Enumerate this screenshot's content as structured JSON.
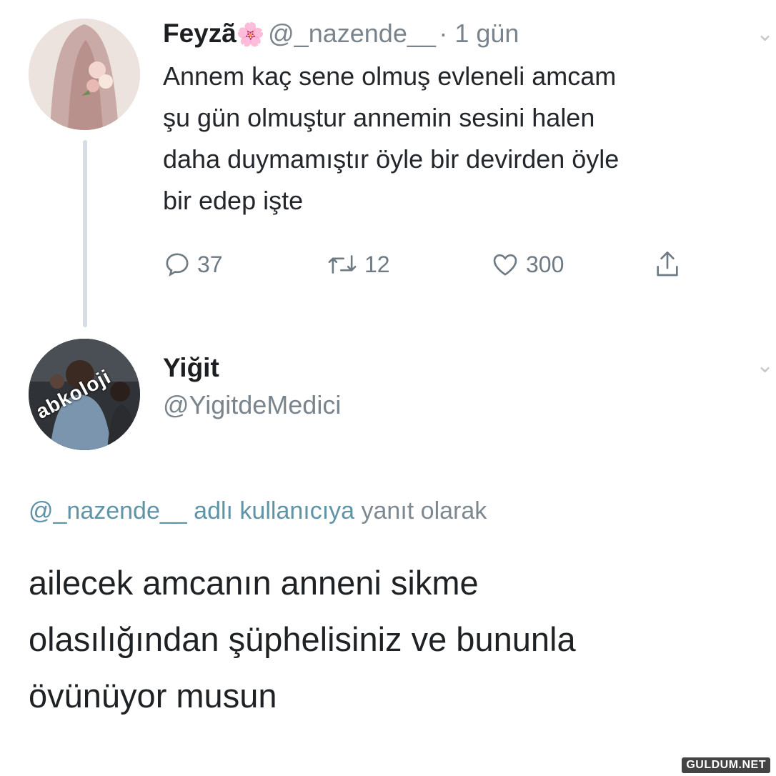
{
  "tweet1": {
    "name": "Feyzã",
    "emoji": "🌸",
    "handle": "@_nazende__",
    "time": "· 1 gün",
    "lines": [
      "Annem kaç sene olmuş evleneli amcam",
      "şu gün olmuştur annemin sesini halen",
      "daha duymamıştır öyle bir devirden öyle",
      "bir edep işte"
    ],
    "actions": {
      "replies": "37",
      "retweets": "12",
      "likes": "300"
    }
  },
  "tweet2": {
    "name": "Yiğit",
    "handle": "@YigitdeMedici",
    "avatar_text": "abkoloji",
    "reply_to_handle": "@_nazende__",
    "reply_to_middle": "adlı kullanıcıya",
    "reply_to_suffix": "yanıt olarak",
    "lines": [
      "ailecek amcanın anneni sikme",
      "olasılığından şüphelisiniz ve bununla",
      "övünüyor musun"
    ]
  },
  "watermark": "GULDUM.NET",
  "colors": {
    "link": "#5f93a7",
    "muted": "#7a848c",
    "thread_line": "#d7dde2"
  },
  "icons": [
    "reply-icon",
    "retweet-icon",
    "like-icon",
    "share-icon",
    "chevron-down-icon"
  ]
}
